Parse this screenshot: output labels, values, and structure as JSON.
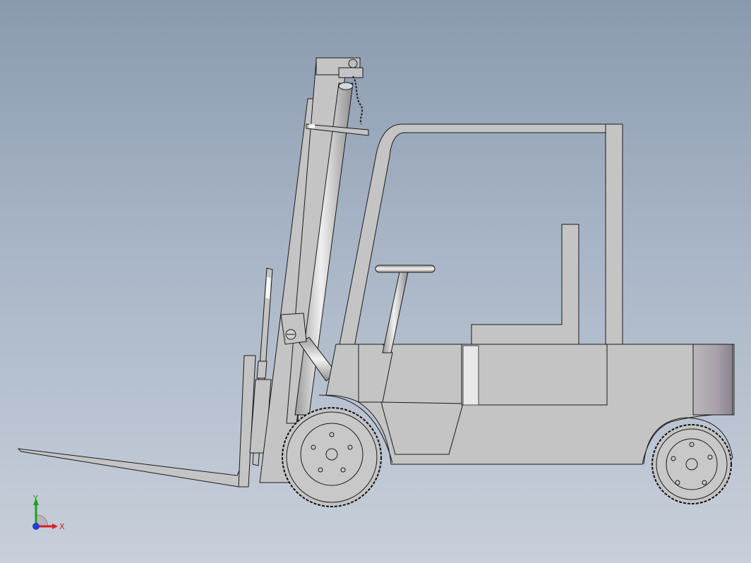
{
  "view": {
    "background_top": "#8a9aae",
    "background_bottom": "#c8cfda",
    "model_fill": "#c4c4c4",
    "model_edge": "#1a1a1a"
  },
  "triad": {
    "x_label": "X",
    "y_label": "Y",
    "x_color": "#d42020",
    "y_color": "#20a020",
    "z_color": "#2040d0"
  }
}
